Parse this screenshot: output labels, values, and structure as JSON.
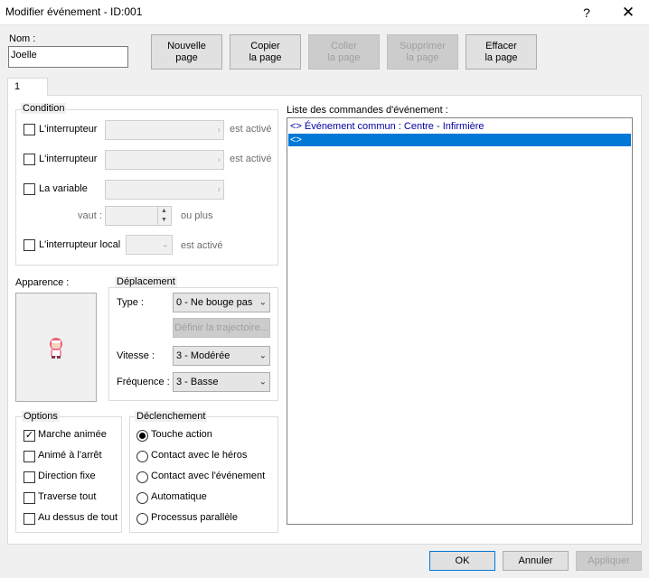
{
  "window": {
    "title": "Modifier événement - ID:001",
    "help": "?",
    "close": "✕"
  },
  "name": {
    "label": "Nom :",
    "value": "Joelle"
  },
  "toolbar": {
    "new_page": "Nouvelle\npage",
    "copy_page": "Copier\nla page",
    "paste_page": "Coller\nla page",
    "delete_page": "Supprimer\nla page",
    "clear_page": "Effacer\nla page"
  },
  "tabs": [
    {
      "label": "1"
    }
  ],
  "condition": {
    "title": "Condition",
    "switch1": {
      "label": "L'interrupteur",
      "suffix": "est activé",
      "checked": false
    },
    "switch2": {
      "label": "L'interrupteur",
      "suffix": "est activé",
      "checked": false
    },
    "variable": {
      "label": "La variable",
      "checked": false
    },
    "value": {
      "label": "vaut :",
      "suffix": "ou plus"
    },
    "local_switch": {
      "label": "L'interrupteur local",
      "suffix": "est activé",
      "checked": false
    }
  },
  "appearance": {
    "label": "Apparence :"
  },
  "movement": {
    "title": "Déplacement",
    "type_label": "Type :",
    "type_value": "0 - Ne bouge pas",
    "route_button": "Définir la trajectoire...",
    "speed_label": "Vitesse :",
    "speed_value": "3 - Modérée",
    "freq_label": "Fréquence :",
    "freq_value": "3 - Basse"
  },
  "options": {
    "title": "Options",
    "items": [
      {
        "label": "Marche animée",
        "checked": true
      },
      {
        "label": "Animé à l'arrêt",
        "checked": false
      },
      {
        "label": "Direction fixe",
        "checked": false
      },
      {
        "label": "Traverse tout",
        "checked": false
      },
      {
        "label": "Au dessus de tout",
        "checked": false
      }
    ]
  },
  "trigger": {
    "title": "Déclenchement",
    "items": [
      {
        "label": "Touche action",
        "selected": true
      },
      {
        "label": "Contact avec le héros",
        "selected": false
      },
      {
        "label": "Contact avec l'événement",
        "selected": false
      },
      {
        "label": "Automatique",
        "selected": false
      },
      {
        "label": "Processus parallèle",
        "selected": false
      }
    ]
  },
  "commands": {
    "title": "Liste des commandes d'événement :",
    "items": [
      {
        "prefix": "<>",
        "text": "Événement commun : Centre - Infirmière",
        "selected": false
      },
      {
        "prefix": "<>",
        "text": "",
        "selected": true
      }
    ]
  },
  "footer": {
    "ok": "OK",
    "cancel": "Annuler",
    "apply": "Appliquer"
  },
  "colors": {
    "selection": "#0078d7",
    "command_text": "#0000a0",
    "disabled_text": "#a0a0a0"
  }
}
